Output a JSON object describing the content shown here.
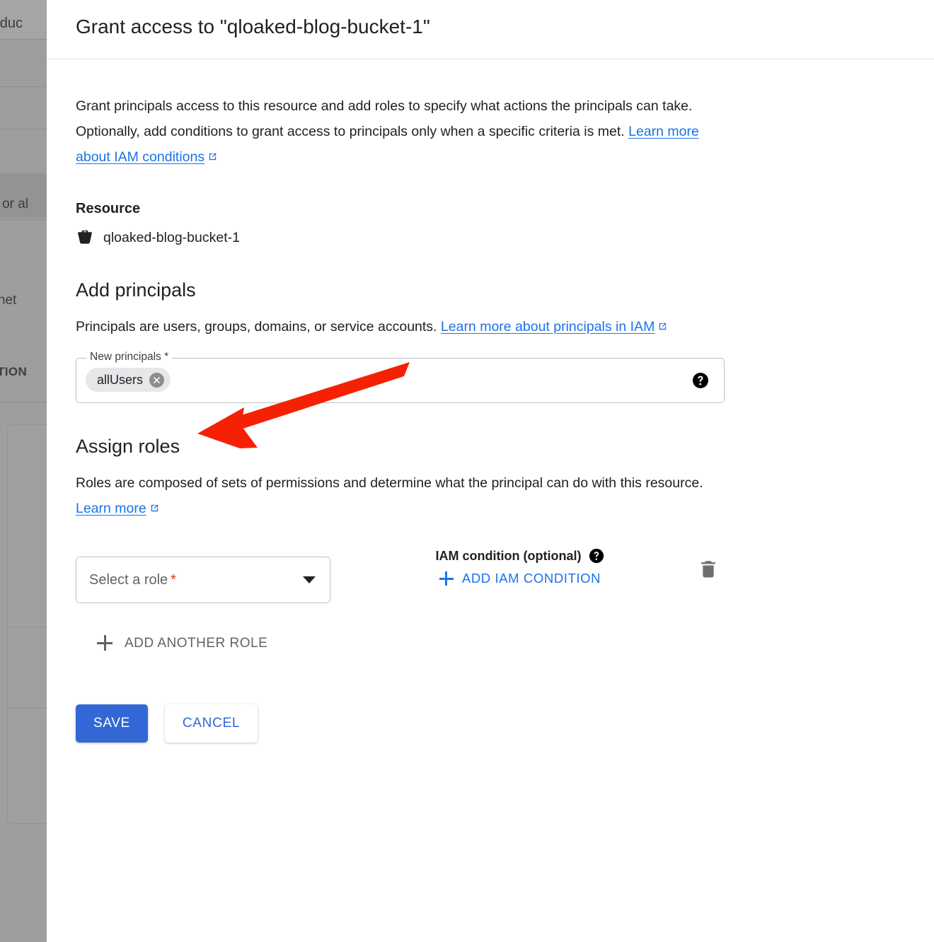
{
  "dialog": {
    "title": "Grant access to \"qloaked-blog-bucket-1\"",
    "intro_text_1": "Grant principals access to this resource and add roles to specify what actions the principals can take. Optionally, add conditions to grant access to principals only when a specific criteria is met. ",
    "intro_link": "Learn more about IAM conditions"
  },
  "resource": {
    "label": "Resource",
    "icon": "bucket-icon",
    "name": "qloaked-blog-bucket-1"
  },
  "add_principals": {
    "heading": "Add principals",
    "description": "Principals are users, groups, domains, or service accounts. ",
    "description_link": "Learn more about principals in IAM",
    "field_label": "New principals *",
    "chips": [
      {
        "label": "allUsers",
        "remove_icon": "close-circle-icon"
      }
    ],
    "help_icon": "help-icon"
  },
  "assign_roles": {
    "heading": "Assign roles",
    "description": "Roles are composed of sets of permissions and determine what the principal can do with this resource. ",
    "description_link": "Learn more",
    "role_select": {
      "placeholder": "Select a role",
      "required_mark": "*",
      "caret_icon": "chevron-down-icon"
    },
    "condition": {
      "label": "IAM condition (optional)",
      "help_icon": "help-icon",
      "add_label": "ADD IAM CONDITION",
      "add_icon": "plus-icon"
    },
    "delete_icon": "trash-icon",
    "add_another_role": "ADD ANOTHER ROLE",
    "add_another_role_icon": "plus-icon"
  },
  "actions": {
    "save_label": "SAVE",
    "cancel_label": "CANCEL"
  },
  "background_page": {
    "fragments": [
      {
        "text": "roduc"
      },
      {
        "text": "rs or al"
      },
      {
        "text": "ernet"
      },
      {
        "text": "TION"
      }
    ]
  },
  "colors": {
    "accent_blue": "#1a73e8",
    "save_button": "#3367d6",
    "required_red": "#d93025",
    "annotation_red": "#f52105",
    "chip_bg": "#e6e7e8",
    "text_primary": "#202124",
    "text_secondary": "#5f6368"
  }
}
